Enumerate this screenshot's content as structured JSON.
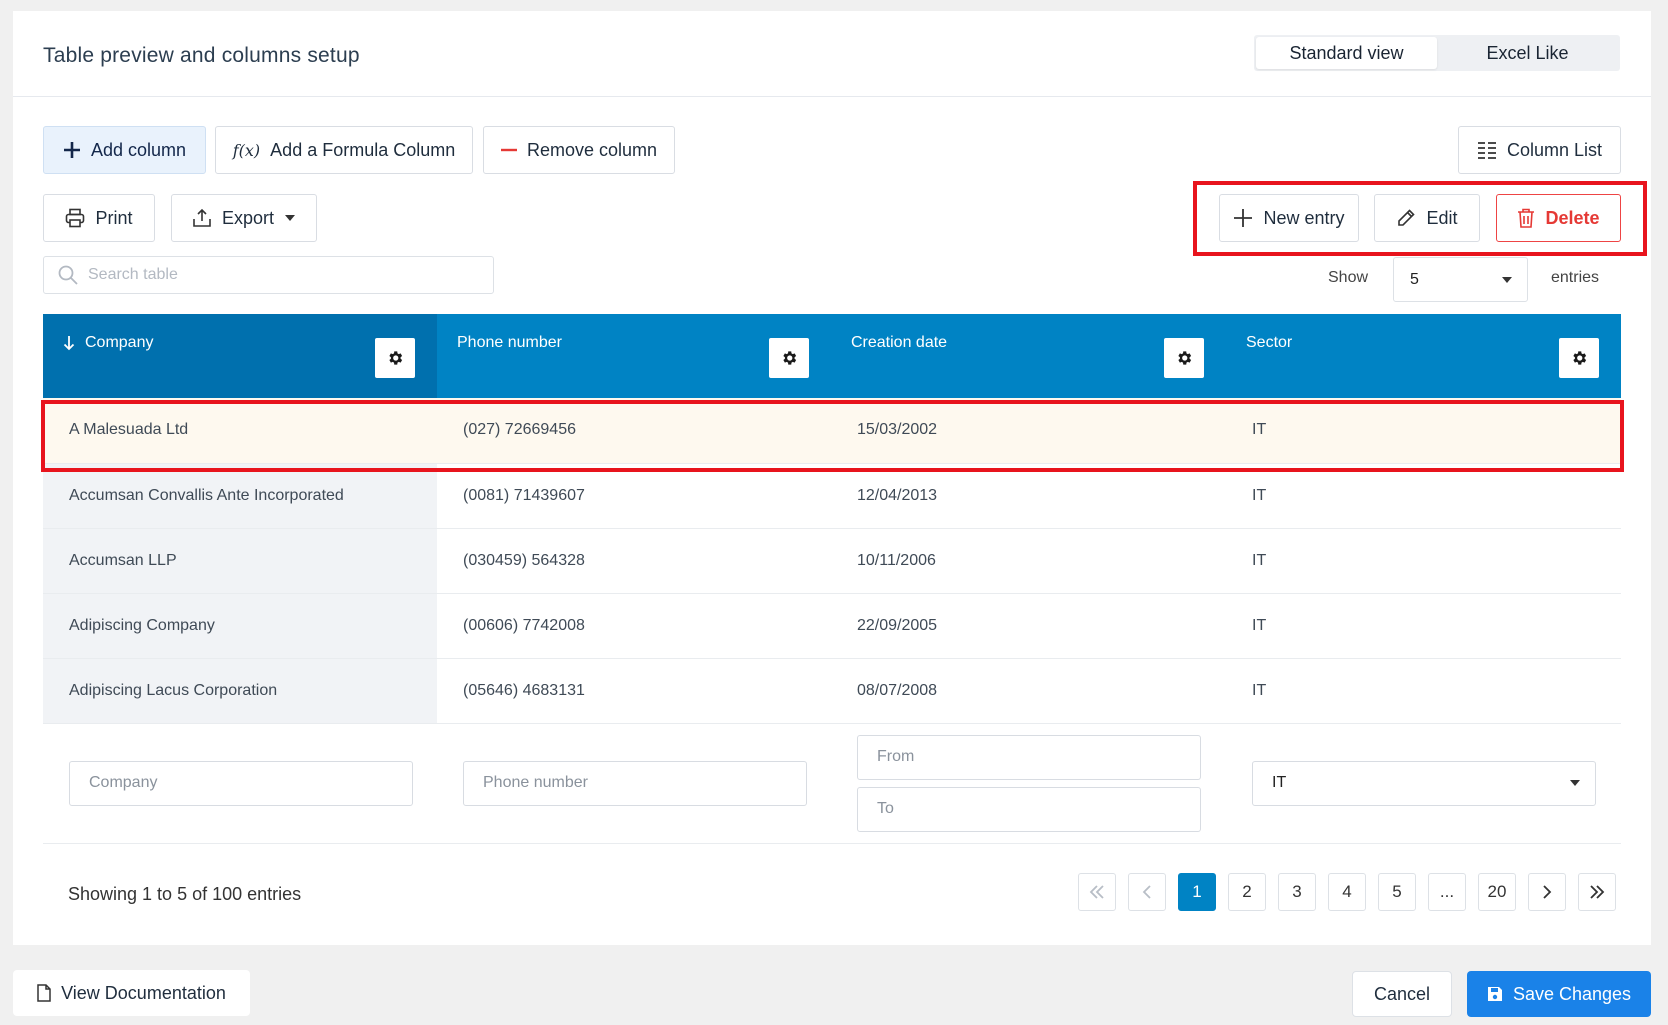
{
  "header": {
    "title": "Table preview and columns setup",
    "view_options": [
      "Standard view",
      "Excel Like"
    ],
    "active_view": "Standard view"
  },
  "toolbar": {
    "add_column": "Add column",
    "add_formula": "Add a Formula Column",
    "remove_column": "Remove column",
    "column_list": "Column List",
    "print": "Print",
    "export": "Export",
    "new_entry": "New entry",
    "edit": "Edit",
    "delete": "Delete"
  },
  "search": {
    "placeholder": "Search table"
  },
  "entries_control": {
    "show_label": "Show",
    "value": "5",
    "entries_label": "entries"
  },
  "table": {
    "columns": [
      "Company",
      "Phone number",
      "Creation date",
      "Sector"
    ],
    "sorted_column": "Company",
    "rows": [
      [
        "A Malesuada Ltd",
        "(027) 72669456",
        "15/03/2002",
        "IT"
      ],
      [
        "Accumsan Convallis Ante Incorporated",
        "(0081) 71439607",
        "12/04/2013",
        "IT"
      ],
      [
        "Accumsan LLP",
        "(030459) 564328",
        "10/11/2006",
        "IT"
      ],
      [
        "Adipiscing Company",
        "(00606) 7742008",
        "22/09/2005",
        "IT"
      ],
      [
        "Adipiscing Lacus Corporation",
        "(05646) 4683131",
        "08/07/2008",
        "IT"
      ]
    ],
    "selected_row": 0,
    "filters": {
      "company_placeholder": "Company",
      "phone_placeholder": "Phone number",
      "from_placeholder": "From",
      "to_placeholder": "To",
      "sector_value": "IT"
    }
  },
  "pagination": {
    "summary": "Showing 1 to 5 of 100 entries",
    "pages": [
      "1",
      "2",
      "3",
      "4",
      "5",
      "...",
      "20"
    ],
    "current": "1"
  },
  "footer": {
    "view_docs": "View Documentation",
    "cancel": "Cancel",
    "save": "Save Changes"
  },
  "colors": {
    "header_blue": "#0083c4",
    "header_blue_sorted": "#0070ae",
    "save_blue": "#1a82e8",
    "danger": "#e53935",
    "highlight_red": "#e8141d",
    "selected_row": "#fef9ef"
  },
  "icons": {
    "add": "plus-icon",
    "formula": "function-icon",
    "remove": "minus-icon",
    "column_list": "list-icon",
    "print": "printer-icon",
    "export": "upload-icon",
    "new_entry": "plus-icon",
    "edit": "pencil-icon",
    "delete": "trash-icon",
    "search": "search-icon",
    "gear": "gear-icon",
    "sort": "arrow-down-icon",
    "doc": "document-icon",
    "save": "floppy-icon"
  }
}
